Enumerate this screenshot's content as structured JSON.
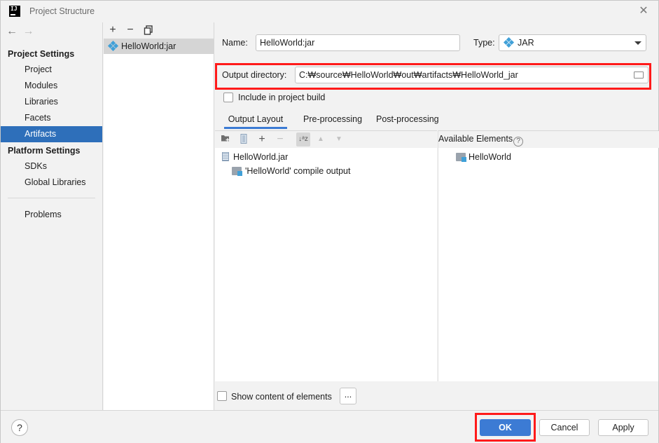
{
  "window": {
    "title": "Project Structure",
    "app_icon_text": "IJ",
    "close_glyph": "✕"
  },
  "nav": {
    "back_glyph": "←",
    "forward_glyph": "→",
    "project_settings_header": "Project Settings",
    "project_settings_items": [
      "Project",
      "Modules",
      "Libraries",
      "Facets",
      "Artifacts"
    ],
    "platform_settings_header": "Platform Settings",
    "platform_settings_items": [
      "SDKs",
      "Global Libraries"
    ],
    "problems_label": "Problems",
    "selected": "Artifacts"
  },
  "artifact_list": {
    "toolbar": {
      "add_glyph": "+",
      "remove_glyph": "−",
      "copy_icon": "copy-icon"
    },
    "items": [
      "HelloWorld:jar"
    ]
  },
  "form": {
    "name_label": "Name:",
    "name_value": "HelloWorld:jar",
    "type_label": "Type:",
    "type_value": "JAR",
    "output_dir_label": "Output directory:",
    "output_dir_value": "C:₩source₩HelloWorld₩out₩artifacts₩HelloWorld_jar",
    "include_in_build_label": "Include in project build",
    "include_in_build_checked": false
  },
  "tabs": [
    "Output Layout",
    "Pre-processing",
    "Post-processing"
  ],
  "active_tab": "Output Layout",
  "layout_tree": {
    "root": "HelloWorld.jar",
    "children": [
      "'HelloWorld' compile output"
    ]
  },
  "available_elements": {
    "header": "Available Elements",
    "items": [
      "HelloWorld"
    ]
  },
  "show_content_label": "Show content of elements",
  "ellipsis_label": "...",
  "footer": {
    "help_glyph": "?",
    "ok_label": "OK",
    "cancel_label": "Cancel",
    "apply_label": "Apply"
  },
  "colors": {
    "selection": "#2e6fba",
    "primary_button": "#3c7bd4",
    "highlight_annotation": "#ff1a1a",
    "accent_icon": "#40a0d8"
  }
}
